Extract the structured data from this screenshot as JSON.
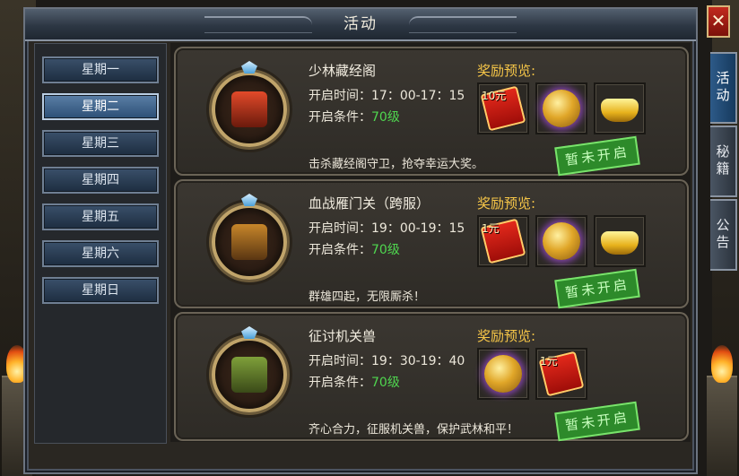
{
  "window": {
    "title": "活动",
    "close_label": "✕"
  },
  "days": [
    {
      "label": "星期一",
      "active": false
    },
    {
      "label": "星期二",
      "active": true
    },
    {
      "label": "星期三",
      "active": false
    },
    {
      "label": "星期四",
      "active": false
    },
    {
      "label": "星期五",
      "active": false
    },
    {
      "label": "星期六",
      "active": false
    },
    {
      "label": "星期日",
      "active": false
    }
  ],
  "side_tabs": [
    {
      "label": "活动",
      "active": true
    },
    {
      "label": "秘籍",
      "active": false
    },
    {
      "label": "公告",
      "active": false
    }
  ],
  "reward_title": "奖励预览:",
  "status_stamp": "暂未开启",
  "activities": [
    {
      "name": "少林藏经阁",
      "time_label": "开启时间：",
      "time": "17：00-17：15",
      "cond_label": "开启条件：",
      "level": "70级",
      "desc": "击杀藏经阁守卫，抢夺幸运大奖。",
      "emblem_icon": "pagoda-icon",
      "rewards": [
        {
          "icon": "red-packet-icon",
          "label": "10元"
        },
        {
          "icon": "gold-coin-icon",
          "label": ""
        },
        {
          "icon": "gold-ingot-icon",
          "label": ""
        }
      ]
    },
    {
      "name": "血战雁门关（跨服）",
      "time_label": "开启时间：",
      "time": "19：00-19：15",
      "cond_label": "开启条件：",
      "level": "70级",
      "desc": "群雄四起，无限厮杀！",
      "emblem_icon": "fortress-gate-icon",
      "rewards": [
        {
          "icon": "red-packet-icon",
          "label": "1元"
        },
        {
          "icon": "gold-coin-icon",
          "label": ""
        },
        {
          "icon": "gold-ingot-icon",
          "label": ""
        }
      ]
    },
    {
      "name": "征讨机关兽",
      "time_label": "开启时间：",
      "time": "19：30-19：40",
      "cond_label": "开启条件：",
      "level": "70级",
      "desc": "齐心合力，征服机关兽，保护武林和平！",
      "emblem_icon": "mechanical-beast-icon",
      "rewards": [
        {
          "icon": "gold-coin-icon",
          "label": ""
        },
        {
          "icon": "red-packet-icon",
          "label": "1元"
        }
      ]
    }
  ]
}
